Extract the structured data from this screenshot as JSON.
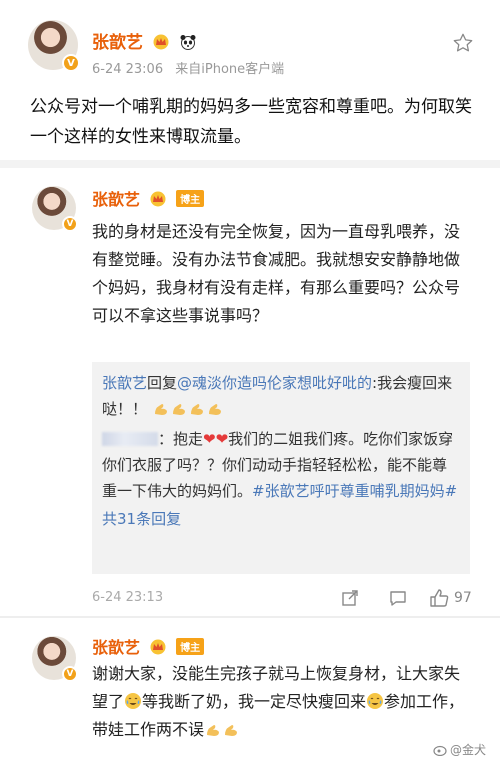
{
  "post": {
    "author": "张歆艺",
    "timestamp": "6-24 23:06",
    "client": "来自iPhone客户端",
    "text": "公众号对一个哺乳期的妈妈多一些宽容和尊重吧。为何取笑一个这样的女性来博取流量。"
  },
  "comment1": {
    "author": "张歆艺",
    "badge": "博主",
    "text": "我的身材是还没有完全恢复，因为一直母乳喂养，没有整觉睡。没有办法节食减肥。我就想安安静静地做个妈妈，我身材有没有走样，有那么重要吗？公众号可以不拿这些事说事吗？",
    "replies": {
      "reply1_author": "张歆艺",
      "reply1_verb": "回复",
      "reply1_target": "@魂淡你造吗伦家想吡好吡的",
      "reply1_text": ":我会瘦回来哒！！",
      "reply2_prefix": "：抱走",
      "reply2_text": "我们的二姐我们疼。吃你们家饭穿你们衣服了吗？？你们动动手指轻轻松松，能不能尊重一下伟大的妈妈们。",
      "reply2_hashtag": "#张歆艺呼吁尊重哺乳期妈妈#",
      "total_replies": "共31条回复"
    },
    "timestamp": "6-24 23:13",
    "like_count": "97"
  },
  "comment2": {
    "author": "张歆艺",
    "badge": "博主",
    "text_part1": "谢谢大家，没能生完孩子就马上恢复身材，让大家失望了",
    "text_part2": "等我断了奶，我一定尽快瘦回来",
    "text_part3": "参加工作，带娃工作两不误"
  },
  "watermark": "@金犬",
  "colors": {
    "name": "#e8600a",
    "link": "#4a78b8",
    "badge": "#f6a218"
  }
}
